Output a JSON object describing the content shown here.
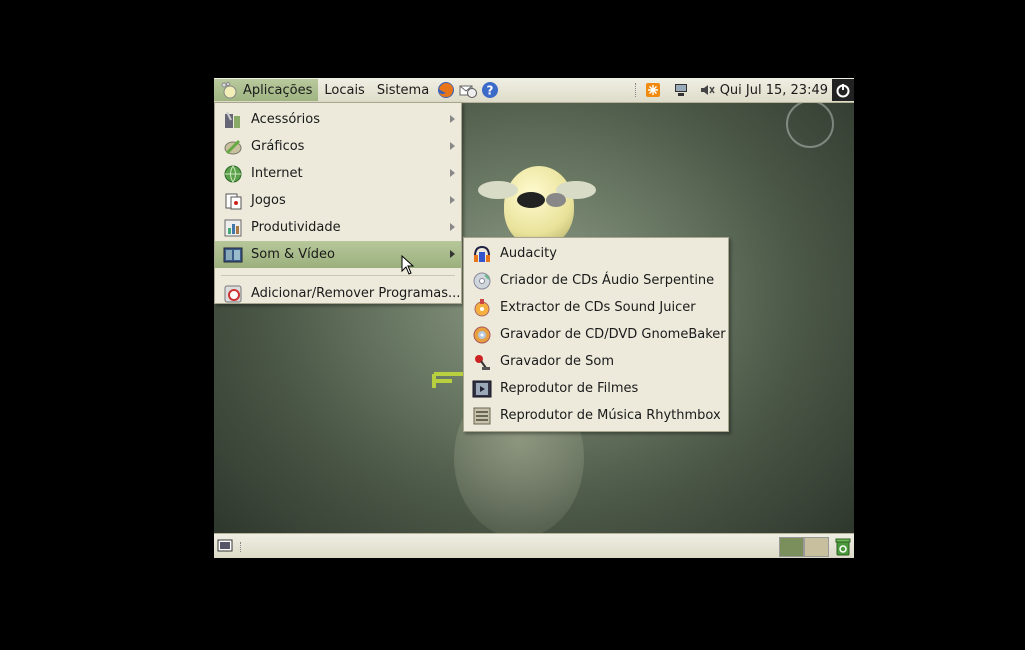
{
  "top_panel": {
    "menus": [
      "Aplicações",
      "Locais",
      "Sistema"
    ],
    "clock": "Qui Jul 15, 23:49"
  },
  "apps_menu": {
    "items": [
      {
        "label": "Acessórios",
        "icon": "accessories-icon",
        "submenu": true
      },
      {
        "label": "Gráficos",
        "icon": "graphics-icon",
        "submenu": true
      },
      {
        "label": "Internet",
        "icon": "internet-icon",
        "submenu": true
      },
      {
        "label": "Jogos",
        "icon": "games-icon",
        "submenu": true
      },
      {
        "label": "Produtividade",
        "icon": "office-icon",
        "submenu": true
      },
      {
        "label": "Som & Vídeo",
        "icon": "multimedia-icon",
        "submenu": true,
        "highlighted": true
      }
    ],
    "extra": "Adicionar/Remover Programas..."
  },
  "sound_video_menu": {
    "items": [
      {
        "label": "Audacity",
        "icon": "audacity-icon"
      },
      {
        "label": "Criador de CDs Áudio Serpentine",
        "icon": "cd-creator-icon"
      },
      {
        "label": "Extractor de CDs Sound Juicer",
        "icon": "sound-juicer-icon"
      },
      {
        "label": "Gravador de CD/DVD GnomeBaker",
        "icon": "gnomebaker-icon"
      },
      {
        "label": "Gravador de Som",
        "icon": "sound-recorder-icon"
      },
      {
        "label": "Reprodutor de Filmes",
        "icon": "movie-player-icon"
      },
      {
        "label": "Reprodutor de Música Rhythmbox",
        "icon": "rhythmbox-icon"
      }
    ]
  },
  "colors": {
    "panel": "#e8e6d6",
    "highlight": "#a8bb8a",
    "workspace_active": "#7b8f5c",
    "workspace_inactive": "#c8bf9f"
  }
}
